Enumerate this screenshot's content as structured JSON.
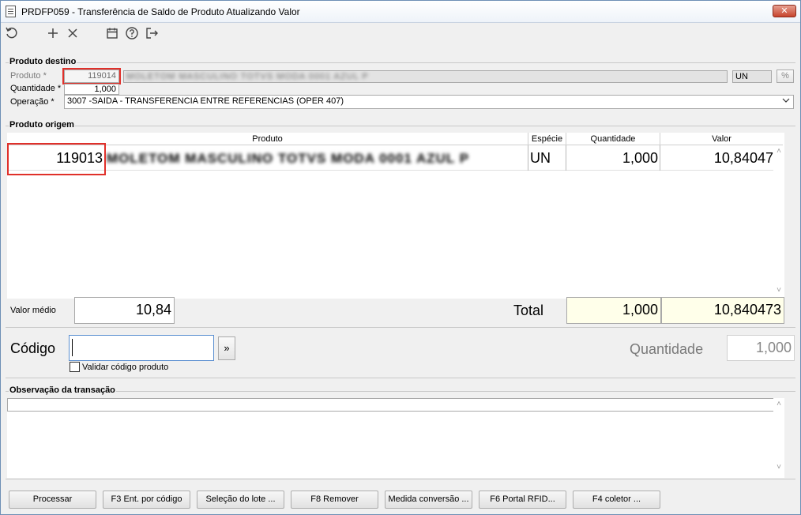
{
  "window": {
    "title": "PRDFP059 - Transferência de Saldo de Produto Atualizando Valor",
    "close": "✕"
  },
  "toolbar": {
    "icons": [
      "refresh-icon",
      "add-icon",
      "delete-icon",
      "calendar-icon",
      "help-icon",
      "exit-icon"
    ]
  },
  "destino": {
    "group_label": "Produto destino",
    "produto_label": "Produto *",
    "produto_value": "119014",
    "produto_desc": "MOLETOM MASCULINO TOTVS MODA 0001 AZUL P",
    "unit": "UN",
    "quantidade_label": "Quantidade *",
    "quantidade_value": "1,000",
    "operacao_label": "Operação *",
    "operacao_value": "3007 -SAIDA - TRANSFERENCIA ENTRE REFERENCIAS (OPER 407)"
  },
  "origem": {
    "group_label": "Produto origem",
    "columns": [
      "Produto",
      "Espécie",
      "Quantidade",
      "Valor"
    ],
    "rows": [
      {
        "codigo": "119013",
        "produto": "MOLETOM MASCULINO TOTVS MODA 0001 AZUL P",
        "especie": "UN",
        "quantidade": "1,000",
        "valor": "10,840473"
      }
    ],
    "valor_medio_label": "Valor médio",
    "valor_medio": "10,84",
    "total_label": "Total",
    "total_quantidade": "1,000",
    "total_valor": "10,840473"
  },
  "entrada": {
    "codigo_label": "Código",
    "codigo_value": "",
    "go_button": "»",
    "validar_label": "Validar código produto",
    "quantidade_label": "Quantidade",
    "quantidade_value": "1,000"
  },
  "observacao": {
    "group_label": "Observação da transação",
    "value": ""
  },
  "buttons": {
    "processar": "Processar",
    "f3": "F3 Ent. por código",
    "selecao": "Seleção do lote ...",
    "f8": "F8 Remover",
    "medida": "Medida conversão ...",
    "f6": "F6 Portal RFID...",
    "f4": "F4 coletor ..."
  }
}
